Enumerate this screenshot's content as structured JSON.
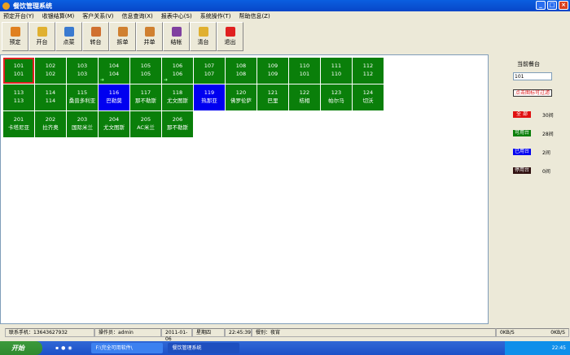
{
  "window": {
    "title": "餐饮管理系统"
  },
  "menu": [
    "预定开台(Y)",
    "收银结算(M)",
    "客户关系(V)",
    "信息查询(X)",
    "报表中心(S)",
    "系统操作(T)",
    "帮助信息(Z)"
  ],
  "toolbar": [
    {
      "label": "预定",
      "icon": "alarm-clock-icon",
      "color": "#e08020"
    },
    {
      "label": "开台",
      "icon": "unlock-icon",
      "color": "#e0b030"
    },
    {
      "label": "点菜",
      "icon": "order-icon",
      "color": "#3a7ad0"
    },
    {
      "label": "转台",
      "icon": "transfer-icon",
      "color": "#d07030"
    },
    {
      "label": "拆单",
      "icon": "split-icon",
      "color": "#d08030"
    },
    {
      "label": "并单",
      "icon": "merge-icon",
      "color": "#d08030"
    },
    {
      "label": "结帐",
      "icon": "checkout-icon",
      "color": "#8040a0"
    },
    {
      "label": "清台",
      "icon": "clear-icon",
      "color": "#e0b030"
    },
    {
      "label": "退出",
      "icon": "exit-icon",
      "color": "#e02020"
    }
  ],
  "tables": [
    {
      "no": "101",
      "name": "101",
      "status": "selected"
    },
    {
      "no": "102",
      "name": "102"
    },
    {
      "no": "103",
      "name": "103"
    },
    {
      "no": "104",
      "name": "104",
      "arrow": true
    },
    {
      "no": "105",
      "name": "105"
    },
    {
      "no": "106",
      "name": "106",
      "arrow": true
    },
    {
      "no": "107",
      "name": "107"
    },
    {
      "no": "108",
      "name": "108"
    },
    {
      "no": "109",
      "name": "109"
    },
    {
      "no": "110",
      "name": "101"
    },
    {
      "no": "111",
      "name": "110"
    },
    {
      "no": "112",
      "name": "112"
    },
    {
      "no": "113",
      "name": "113"
    },
    {
      "no": "114",
      "name": "114"
    },
    {
      "no": "115",
      "name": "桑普多利亚"
    },
    {
      "no": "116",
      "name": "巴勒莫",
      "status": "occupied"
    },
    {
      "no": "117",
      "name": "那不勒斯"
    },
    {
      "no": "118",
      "name": "尤文图斯"
    },
    {
      "no": "119",
      "name": "热那亚",
      "status": "occupied"
    },
    {
      "no": "120",
      "name": "佛罗伦萨"
    },
    {
      "no": "121",
      "name": "巴里"
    },
    {
      "no": "122",
      "name": "桔相"
    },
    {
      "no": "123",
      "name": "帕尔马"
    },
    {
      "no": "124",
      "name": "切沃"
    },
    {
      "no": "201",
      "name": "卡塔尼亚"
    },
    {
      "no": "202",
      "name": "拉齐奥"
    },
    {
      "no": "203",
      "name": "国际米兰"
    },
    {
      "no": "204",
      "name": "尤文图斯"
    },
    {
      "no": "205",
      "name": "AC米兰"
    },
    {
      "no": "206",
      "name": "那不勒斯"
    }
  ],
  "side": {
    "current_label": "当前餐台",
    "current_value": "101",
    "filter_button": "点击图标可过滤",
    "legend": [
      {
        "label": "全 部",
        "count": "30间",
        "color": "#e01010"
      },
      {
        "label": "可用台",
        "count": "28间",
        "color": "#0a7f0a"
      },
      {
        "label": "已用台",
        "count": "2间",
        "color": "#0000f0"
      },
      {
        "label": "停用台",
        "count": "0间",
        "color": "#301010"
      }
    ]
  },
  "status": {
    "phone": "联系手机：13643627932",
    "operator": "操作员：admin",
    "date": "2011-01-06",
    "weekday": "星期四",
    "time": "22:45:39",
    "shift": "餐别：夜宵",
    "net_down": "0KB/S",
    "net_up": "0KB/S"
  },
  "taskbar": {
    "start": "开始",
    "tasks": [
      "F:\\完全可用软件\\",
      "餐饮管理系统"
    ],
    "clock": "22:45"
  }
}
